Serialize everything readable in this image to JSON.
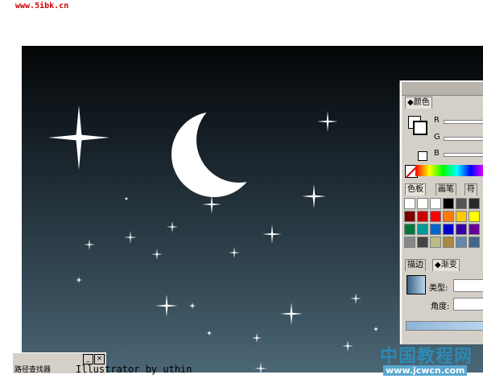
{
  "site_link": "www.5ibk.cn",
  "credit": "Illustrator by uthin",
  "watermark": {
    "title": "中国教程网",
    "url": "www.jcwcn.com"
  },
  "color_palette": {
    "tab_label": "颜色",
    "channels": [
      "R",
      "G",
      "B"
    ]
  },
  "swatch_panel": {
    "tabs": [
      "色板",
      "画笔",
      "符"
    ]
  },
  "gradient_panel": {
    "tabs": [
      "描边",
      "渐变"
    ],
    "type_label": "类型:",
    "angle_label": "角度:"
  },
  "mini_window": {
    "label": "路径查找器"
  },
  "colors": {
    "moon": "#ffffff",
    "stars": "#ffffff"
  }
}
